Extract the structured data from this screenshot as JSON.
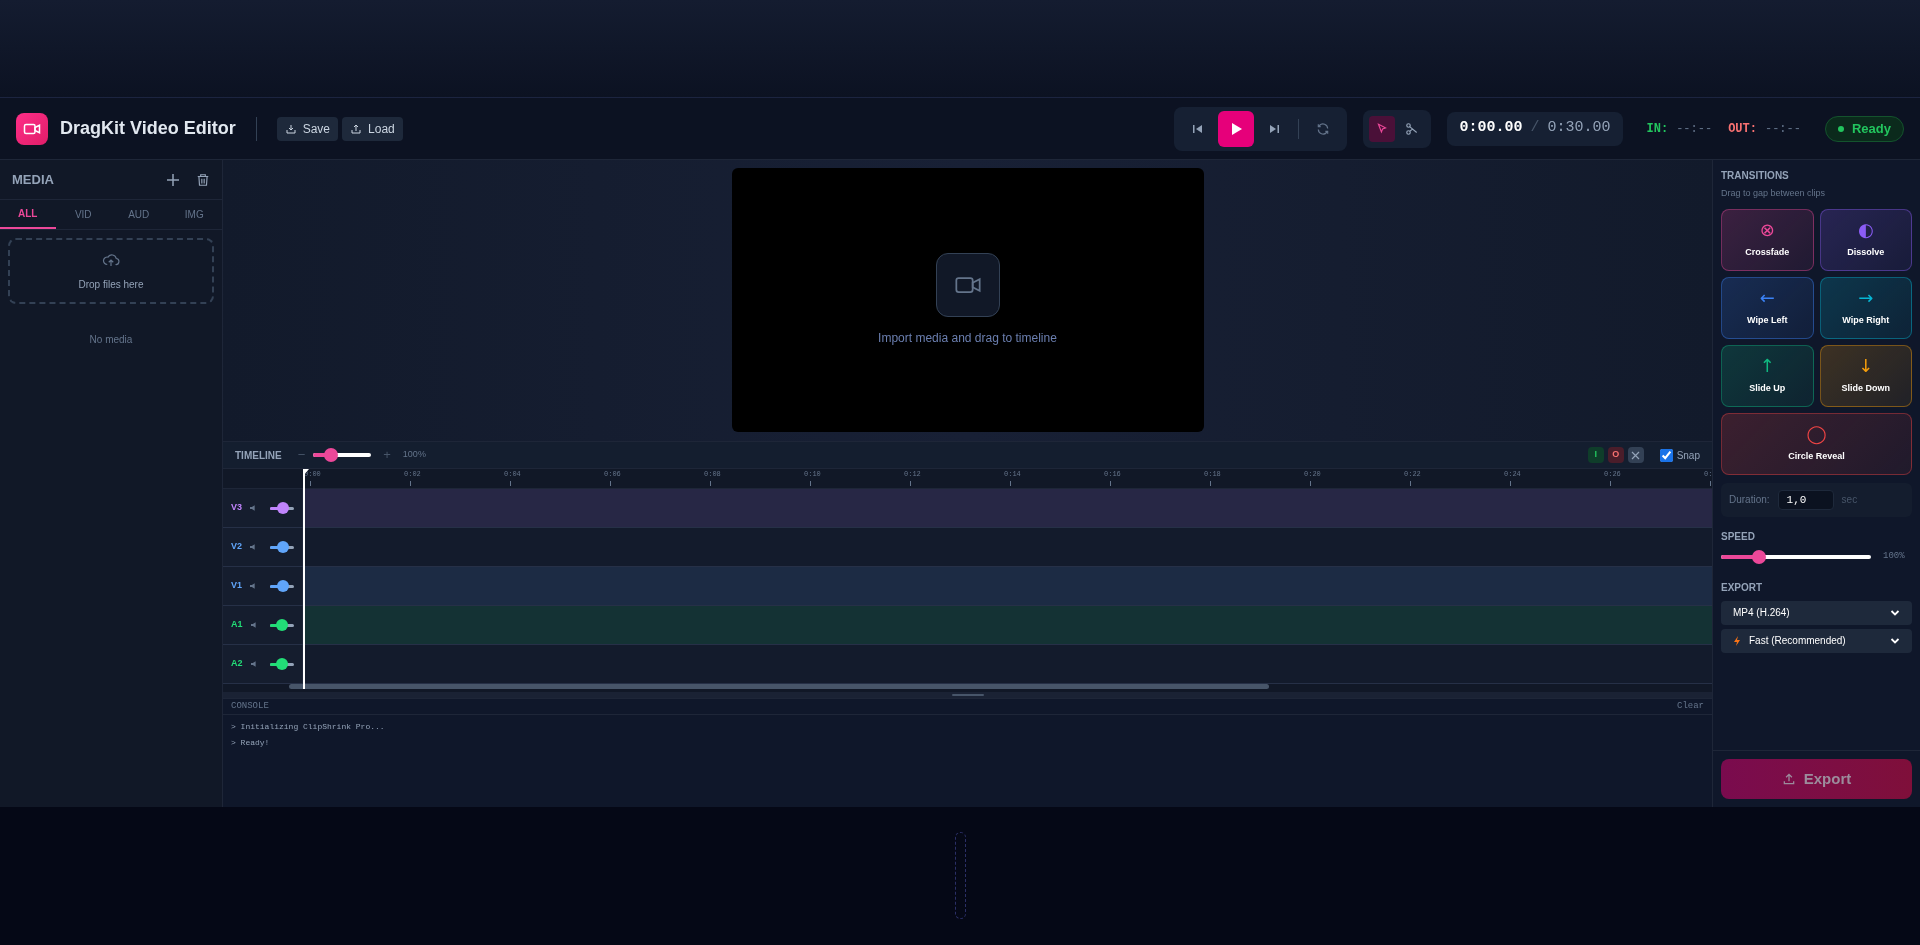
{
  "app": {
    "title": "DragKit Video Editor"
  },
  "file_buttons": [
    {
      "label": "Save",
      "kind": "save"
    },
    {
      "label": "Load",
      "kind": "load"
    }
  ],
  "tools": [
    {
      "kind": "select",
      "selected": true
    },
    {
      "kind": "cut",
      "selected": false
    }
  ],
  "time": {
    "current": "0:00.00",
    "separator": "/",
    "total": "0:30.00"
  },
  "in_out": {
    "in_label": "IN:",
    "in_value": "--:--",
    "out_label": "OUT:",
    "out_value": "--:--"
  },
  "status": "Ready",
  "media": {
    "title": "MEDIA",
    "tabs": [
      {
        "label": "ALL",
        "selected": true
      },
      {
        "label": "VID",
        "selected": false
      },
      {
        "label": "AUD",
        "selected": false
      },
      {
        "label": "IMG",
        "selected": false
      }
    ],
    "dropzone": "Drop files here",
    "empty": "No media"
  },
  "preview": {
    "message": "Import media and drag to timeline"
  },
  "timeline": {
    "title": "TIMELINE",
    "zoom_minus": "−",
    "zoom_plus": "+",
    "zoom": {
      "level": 0.25,
      "reading": "100%"
    },
    "markers": [
      {
        "label": "I",
        "kind": "in"
      },
      {
        "label": "O",
        "kind": "out"
      }
    ],
    "snap": {
      "label": "Snap",
      "checked": true
    },
    "ruler": [
      "0:00",
      "0:02",
      "0:04",
      "0:06",
      "0:08",
      "0:10",
      "0:12",
      "0:14",
      "0:16",
      "0:18",
      "0:20",
      "0:22",
      "0:24",
      "0:26",
      "0:"
    ],
    "tracks": [
      {
        "name": "V3",
        "color": "#c084fc",
        "level": 0.5,
        "tinted": true
      },
      {
        "name": "V2",
        "color": "#60a5fa",
        "level": 0.5,
        "tinted": false
      },
      {
        "name": "V1",
        "color": "#60a5fa",
        "level": 0.5,
        "tinted": true
      },
      {
        "name": "A1",
        "color": "#22dd77",
        "level": 0.4,
        "tinted": true
      },
      {
        "name": "A2",
        "color": "#22dd77",
        "level": 0.4,
        "tinted": false
      }
    ]
  },
  "console": {
    "title": "CONSOLE",
    "clear": "Clear",
    "lines": [
      "> Initializing ClipShrink Pro...",
      "> Ready!"
    ]
  },
  "transitions": {
    "title": "TRANSITIONS",
    "hint": "Drag to gap between clips",
    "items": [
      {
        "label": "Crossfade",
        "symbol": "⊗",
        "color": "#ec4899"
      },
      {
        "label": "Dissolve",
        "symbol": "◐",
        "color": "#8b5cf6"
      },
      {
        "label": "Wipe Left",
        "symbol": "←",
        "color": "#3b82f6"
      },
      {
        "label": "Wipe Right",
        "symbol": "→",
        "color": "#06b6d4"
      },
      {
        "label": "Slide Up",
        "symbol": "↑",
        "color": "#10b981"
      },
      {
        "label": "Slide Down",
        "symbol": "↓",
        "color": "#f59e0b"
      },
      {
        "label": "Circle Reveal",
        "symbol": "◯",
        "color": "#ef4444"
      }
    ],
    "duration": {
      "label": "Duration:",
      "value": "1,0",
      "unit": "sec"
    }
  },
  "speed": {
    "title": "SPEED",
    "level": 0.23,
    "reading": "100%"
  },
  "export": {
    "title": "EXPORT",
    "format": "MP4 (H.264)",
    "preset": "Fast (Recommended)",
    "button": "Export"
  }
}
